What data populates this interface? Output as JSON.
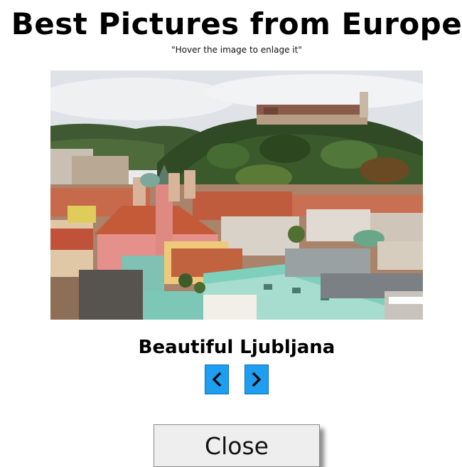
{
  "page": {
    "title": "Best Pictures from Europe",
    "subtitle": "\"Hover the image to enlage it\""
  },
  "gallery": {
    "caption": "Beautiful Ljubljana",
    "prev_icon": "chevron-left-icon",
    "next_icon": "chevron-right-icon",
    "nav_color": "#1d9ef0",
    "close_label": "Close"
  }
}
